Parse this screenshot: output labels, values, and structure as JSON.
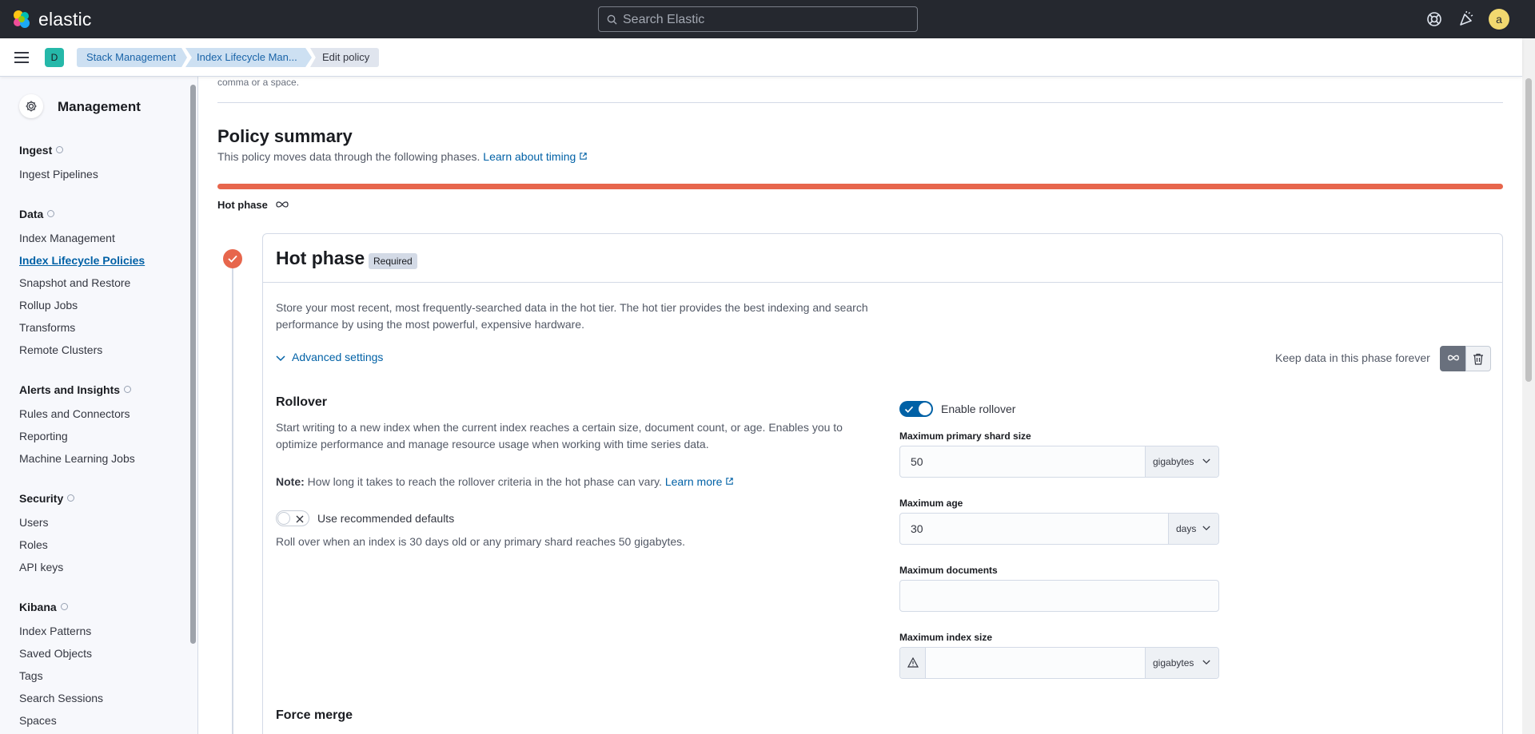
{
  "header": {
    "logo_text": "elastic",
    "search_placeholder": "Search Elastic",
    "avatar_initial": "a",
    "icons": [
      "help-icon",
      "news-icon"
    ]
  },
  "breadcrumbs": {
    "space_initial": "D",
    "items": [
      "Stack Management",
      "Index Lifecycle Man...",
      "Edit policy"
    ]
  },
  "sidebar": {
    "title": "Management",
    "groups": [
      {
        "title": "Ingest",
        "items": [
          "Ingest Pipelines"
        ]
      },
      {
        "title": "Data",
        "items": [
          "Index Management",
          "Index Lifecycle Policies",
          "Snapshot and Restore",
          "Rollup Jobs",
          "Transforms",
          "Remote Clusters"
        ]
      },
      {
        "title": "Alerts and Insights",
        "items": [
          "Rules and Connectors",
          "Reporting",
          "Machine Learning Jobs"
        ]
      },
      {
        "title": "Security",
        "items": [
          "Users",
          "Roles",
          "API keys"
        ]
      },
      {
        "title": "Kibana",
        "items": [
          "Index Patterns",
          "Saved Objects",
          "Tags",
          "Search Sessions",
          "Spaces"
        ]
      }
    ],
    "active_item": "Index Lifecycle Policies"
  },
  "main": {
    "cutoff_text": "comma or a space.",
    "summary_title": "Policy summary",
    "summary_desc": "This policy moves data through the following phases.",
    "summary_link": "Learn about timing",
    "phase_label": "Hot phase",
    "panel": {
      "title": "Hot phase",
      "badge": "Required",
      "desc": "Store your most recent, most frequently-searched data in the hot tier. The hot tier provides the best indexing and search performance by using the most powerful, expensive hardware.",
      "advanced": "Advanced settings",
      "keep_label": "Keep data in this phase forever",
      "rollover": {
        "title": "Rollover",
        "desc": "Start writing to a new index when the current index reaches a certain size, document count, or age. Enables you to optimize performance and manage resource usage when working with time series data.",
        "note_label": "Note:",
        "note_text": "How long it takes to reach the rollover criteria in the hot phase can vary.",
        "note_link": "Learn more",
        "recommended_label": "Use recommended defaults",
        "recommended_on": false,
        "rollover_summary": "Roll over when an index is 30 days old or any primary shard reaches 50 gigabytes.",
        "enable_label": "Enable rollover",
        "enable_on": true,
        "fields": {
          "shard_label": "Maximum primary shard size",
          "shard_value": "50",
          "shard_unit": "gigabytes",
          "age_label": "Maximum age",
          "age_value": "30",
          "age_unit": "days",
          "docs_label": "Maximum documents",
          "docs_value": "",
          "index_label": "Maximum index size",
          "index_value": "",
          "index_unit": "gigabytes"
        }
      },
      "force_merge_title": "Force merge"
    }
  },
  "colors": {
    "header_bg": "#25282f",
    "accent_blue": "#0061a6",
    "hot_phase": "#e7664c",
    "breadcrumb_bg": "#cde0f2"
  }
}
